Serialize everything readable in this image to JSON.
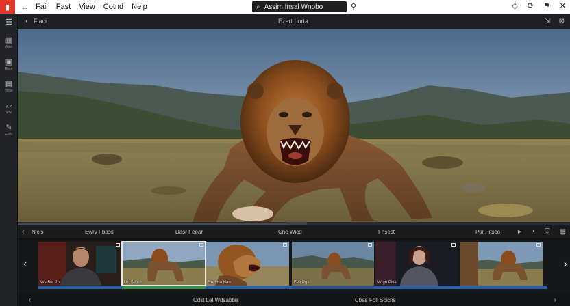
{
  "menubar": {
    "back_icon": "←",
    "items": [
      "Fail",
      "Fast",
      "View",
      "Cotnd",
      "Nelp"
    ],
    "search": {
      "value": "Assim fnsal Wnobo",
      "icon": "⌕",
      "mic_icon": "⚲"
    },
    "right_icons": [
      "◇",
      "⟳",
      "⚑",
      "✕"
    ]
  },
  "leftbar": {
    "tools": [
      {
        "icon": "☰",
        "label": ""
      },
      {
        "icon": "▥",
        "label": "Ablo"
      },
      {
        "icon": "▣",
        "label": "Eem"
      },
      {
        "icon": "▤",
        "label": "Nnse"
      },
      {
        "icon": "▱",
        "label": "Pnt"
      },
      {
        "icon": "✎",
        "label": "Ensl"
      }
    ]
  },
  "viewer": {
    "back_icon": "‹",
    "crumb": "Flaci",
    "title": "Ezert Lorta",
    "right_icons": [
      "⇲",
      "⊠"
    ]
  },
  "timeline": {
    "back_icon": "‹",
    "labels": [
      "Nlcls",
      "Ewry Fbass",
      "Dasr Feear",
      "Cne Wicd",
      "Fnsest",
      "Psr Pitsco"
    ],
    "right_icons": [
      "▸",
      "◔",
      "⛉",
      "▤"
    ]
  },
  "clips": [
    {
      "caption": "Ws Bel Pbl",
      "scene": "person",
      "selected": false
    },
    {
      "caption": "Urt Seoch",
      "scene": "lion-small",
      "selected": true
    },
    {
      "caption": "Exel Ha Nao",
      "scene": "lion-close",
      "selected": false
    },
    {
      "caption": "Eve Pgs",
      "scene": "lion-field",
      "selected": false
    },
    {
      "caption": "Wrgtt Pitia",
      "scene": "woman",
      "selected": false
    },
    {
      "caption": "",
      "scene": "lion-pair",
      "selected": false
    }
  ],
  "nav": {
    "prev_icon": "‹",
    "next_icon": "›"
  },
  "bottombar": {
    "prev_icon": "‹",
    "next_icon": "›",
    "labels": [
      "Cdst Lel Wdsabbis",
      "Cbas Foll Scicns"
    ]
  },
  "colors": {
    "accent": "#e53528",
    "track": "#2d5d9b",
    "track_green": "#3f8a4f",
    "selection": "#e9e9e9"
  }
}
